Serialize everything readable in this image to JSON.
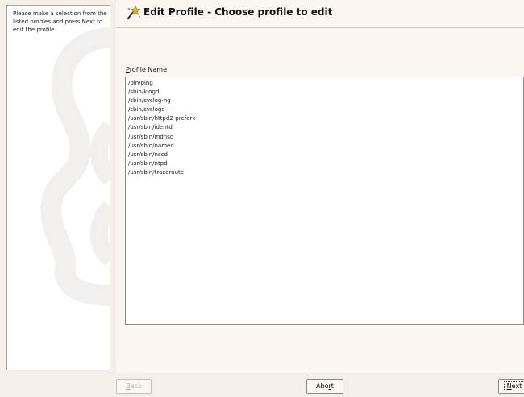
{
  "help": {
    "text": "Please make a selection from the listed profiles and press Next to edit the profile."
  },
  "header": {
    "title": "Edit Profile - Choose profile to edit",
    "icon": "apparmor-wand-icon"
  },
  "list": {
    "label_mnemonic": "P",
    "label_rest": "rofile Name",
    "items": [
      "/bin/ping",
      "/sbin/klogd",
      "/sbin/syslog-ng",
      "/sbin/syslogd",
      "/usr/sbin/httpd2-prefork",
      "/usr/sbin/identd",
      "/usr/sbin/mdnsd",
      "/usr/sbin/named",
      "/usr/sbin/nscd",
      "/usr/sbin/ntpd",
      "/usr/sbin/traceroute"
    ]
  },
  "buttons": {
    "back": {
      "mnemonic": "B",
      "rest": "ack",
      "enabled": false
    },
    "abort": {
      "before": "Abo",
      "mnemonic": "r",
      "after": "t",
      "enabled": true
    },
    "next": {
      "mnemonic": "N",
      "rest": "ext",
      "enabled": true
    }
  },
  "colors": {
    "background": "#f4efe8",
    "panel": "#fbf7f0",
    "list_bg": "#ffffff"
  }
}
